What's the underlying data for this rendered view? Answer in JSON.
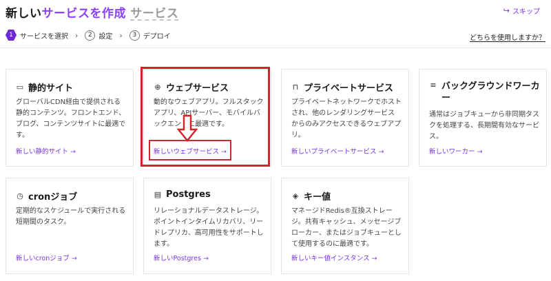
{
  "header": {
    "title_prefix": "新しい",
    "title_accent": "サービスを作成",
    "title_suffix": "サービス",
    "skip_label": "スキップ",
    "which_to_use": "どちらを使用しますか？"
  },
  "steps": [
    {
      "num": "1",
      "label": "サービスを選択"
    },
    {
      "num": "2",
      "label": "設定"
    },
    {
      "num": "3",
      "label": "デプロイ"
    }
  ],
  "cards": [
    {
      "title": "静的サイト",
      "icon": "static-site-icon",
      "desc": "グローバルCDN経由で提供される静的コンテンツ。フロントエンド、ブログ、コンテンツサイトに最適です。",
      "link": "新しい静的サイト →"
    },
    {
      "title": "ウェブサービス",
      "icon": "globe-icon",
      "desc": "動的なウェブアプリ。フルスタックアプリ、APIサーバー、モバイルバックエンドに最適です。",
      "link": "新しいウェブサービス →"
    },
    {
      "title": "プライベートサービス",
      "icon": "lock-icon",
      "desc": "プライベートネットワークでホストされ、他のレンダリングサービスからのみアクセスできるウェブアプリ。",
      "link": "新しいプライベートサービス →"
    },
    {
      "title": "バックグラウンドワーカー",
      "icon": "list-icon",
      "desc": "通常はジョブキューから非同期タスクを処理する、長期間有効なサービス。",
      "link": "新しいワーカー →"
    },
    {
      "title": "cronジョブ",
      "icon": "timer-icon",
      "desc": "定期的なスケジュールで実行される短期間のタスク。",
      "link": "新しいcronジョブ →"
    },
    {
      "title": "Postgres",
      "icon": "database-icon",
      "desc": "リレーショナルデータストレージ。ポイントインタイムリカバリ、リードレプリカ、高可用性をサポートします。",
      "link": "新しいPostgres →"
    },
    {
      "title": "キー値",
      "icon": "layers-icon",
      "desc": "マネージドRedis®互換ストレージ。共有キャッシュ、メッセージブローカー、またはジョブキューとして使用するのに最適です。",
      "link": "新しいキー値インスタンス →"
    }
  ],
  "colors": {
    "accent": "#8a3ffc",
    "link": "#7a35e0",
    "highlight": "#d3232b"
  }
}
